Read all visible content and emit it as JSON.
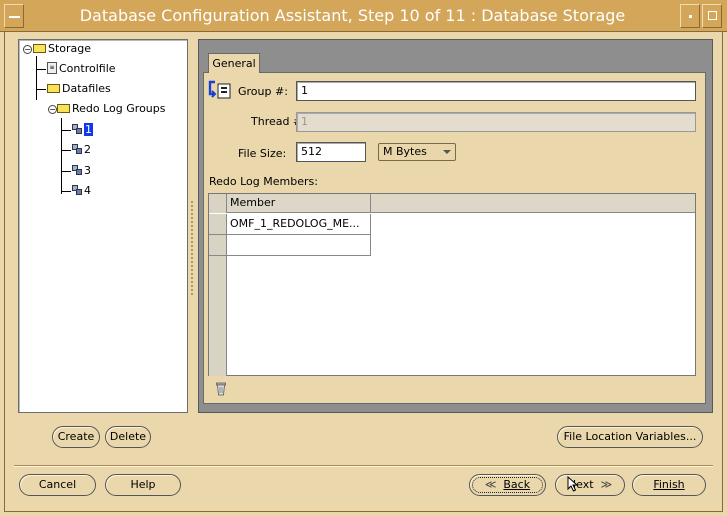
{
  "window": {
    "title": "Database Configuration Assistant, Step 10 of 11 : Database Storage"
  },
  "tree": {
    "root": "Storage",
    "items": {
      "controlfile": "Controlfile",
      "datafiles": "Datafiles",
      "redo_log_groups": "Redo Log Groups"
    },
    "groups": [
      "1",
      "2",
      "3",
      "4"
    ],
    "selected_group": "1"
  },
  "left_buttons": {
    "create": "Create",
    "delete": "Delete"
  },
  "tabs": {
    "general": "General"
  },
  "form": {
    "group_label": "Group #:",
    "group_value": "1",
    "thread_label": "Thread #:",
    "thread_value": "1",
    "file_size_label": "File Size:",
    "file_size_value": "512",
    "unit_value": "M Bytes",
    "members_label": "Redo Log Members:"
  },
  "members_table": {
    "header": "Member",
    "rows": [
      "OMF_1_REDOLOG_ME...",
      ""
    ]
  },
  "file_location_button": "File Location Variables...",
  "footer": {
    "cancel": "Cancel",
    "help": "Help",
    "back": "Back",
    "next": "Next",
    "finish": "Finish"
  },
  "icons": {
    "trash": "trash-icon",
    "group": "redo-log-group-icon"
  }
}
